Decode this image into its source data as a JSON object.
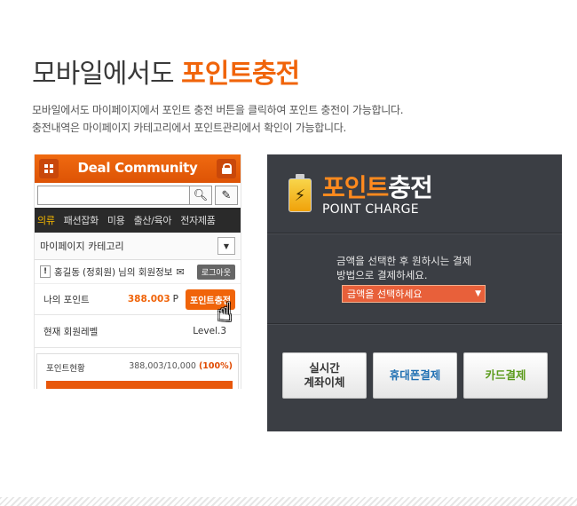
{
  "header": {
    "title_normal": "모바일에서도",
    "title_accent": "포인트충전",
    "desc_line1": "모바일에서도 마이페이지에서 포인트 충전 버튼을 클릭하여 포인트 충전이 가능합니다.",
    "desc_line2": "충전내역은 마이페이지 카테고리에서 포인트관리에서 확인이 가능합니다."
  },
  "mobile": {
    "logo": "Deal Community",
    "nav": [
      "의류",
      "패션잡화",
      "미용",
      "출산/육아",
      "전자제품"
    ],
    "category": "마이페이지 카테고리",
    "user_name": "홍길동",
    "user_grade": "(정회원)",
    "user_suffix": "님의 회원정보",
    "logout": "로그아웃",
    "point_label": "나의 포인트",
    "point_value": "388.003",
    "point_unit": "P",
    "charge_button": "포인트충전",
    "level_label": "현재 회원레벨",
    "level_value": "Level.3",
    "status_label": "포인트현황",
    "status_nums": "388,003/10,000",
    "status_pct": "(100%)",
    "status_fill": 1.0
  },
  "panel": {
    "title_a": "포인트",
    "title_b": "충전",
    "subtitle": "POINT CHARGE",
    "instr_line1": "금액을 선택한 후 원하시는 결제",
    "instr_line2": "방법으로 결제하세요.",
    "select_value": "금액을 선택하세요",
    "pay_bank_line1": "실시간",
    "pay_bank_line2": "계좌이체",
    "pay_phone": "휴대폰결제",
    "pay_card": "카드결제"
  },
  "colors": {
    "accent": "#f0640a",
    "panel_bg": "#3b3e44",
    "phone_pay": "#1f6fb2",
    "card_pay": "#5a9a1a"
  }
}
